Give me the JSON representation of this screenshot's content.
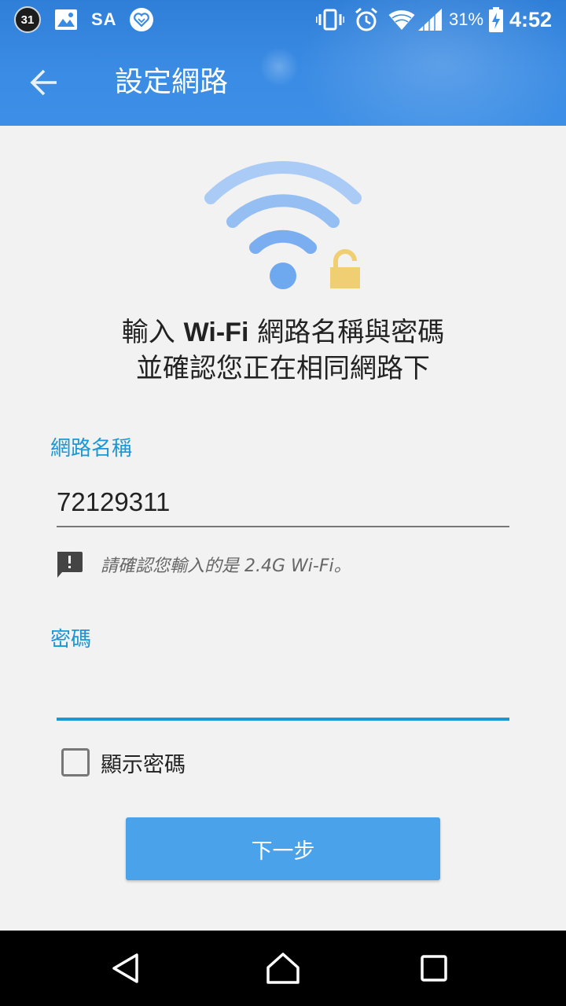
{
  "statusbar": {
    "calendar_badge": "31",
    "carrier_text": "SA",
    "battery_percent": "31%",
    "time": "4:52",
    "icons": [
      "calendar-badge-icon",
      "image-icon",
      "heart-icon",
      "vibrate-icon",
      "alarm-icon",
      "wifi-icon",
      "signal-icon",
      "battery-charging-icon"
    ]
  },
  "appbar": {
    "back_icon": "arrow-back-icon",
    "title": "設定網路"
  },
  "hero": {
    "icon": "wifi-lock-icon",
    "line1_pre": "輸入 ",
    "line1_bold": "Wi-Fi",
    "line1_post": " 網路名稱與密碼",
    "line2": "並確認您正在相同網路下"
  },
  "form": {
    "ssid_label": "網路名稱",
    "ssid_value": "72129311",
    "warning_icon": "feedback-alert-icon",
    "warning_text": "請確認您輸入的是 2.4G Wi-Fi。",
    "password_label": "密碼",
    "password_value": "",
    "show_password_label": "顯示密碼",
    "show_password_checked": false,
    "next_button": "下一步"
  },
  "navbar": {
    "icons": [
      "nav-back-icon",
      "nav-home-icon",
      "nav-recents-icon"
    ]
  },
  "colors": {
    "header": "#3a8be4",
    "accent": "#1a97d5",
    "button": "#4aa2ea",
    "background": "#f2f2f2",
    "wifi_icon": "#7aaef0",
    "lock_icon": "#f0cf72"
  }
}
